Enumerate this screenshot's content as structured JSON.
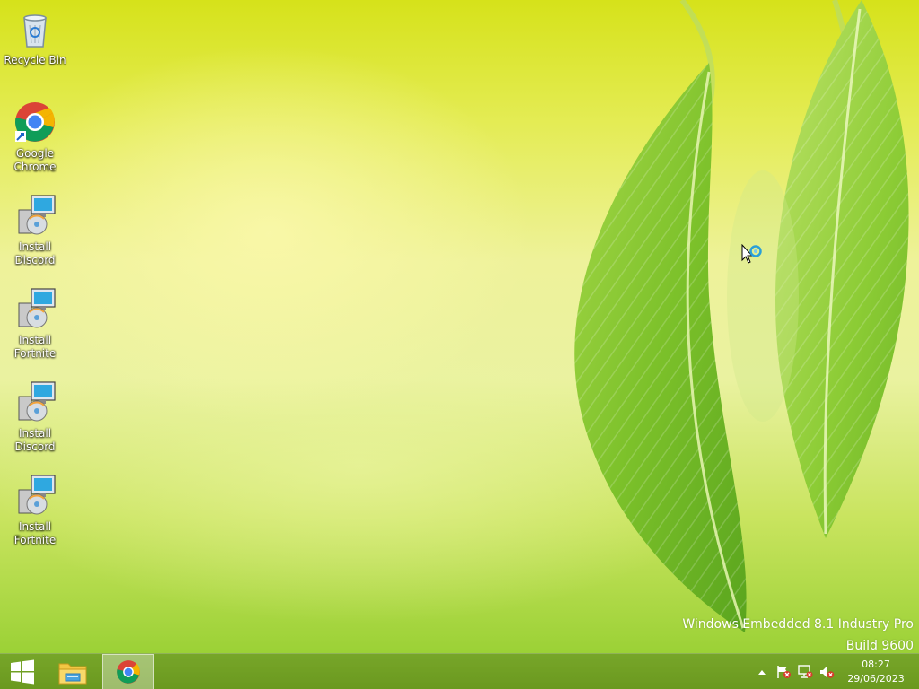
{
  "desktop": {
    "icons": [
      {
        "label": "Recycle Bin",
        "icon": "recycle-bin-icon"
      },
      {
        "label": "Google Chrome",
        "icon": "chrome-icon"
      },
      {
        "label": "Install Discord",
        "icon": "installer-icon"
      },
      {
        "label": "Install Fortnite",
        "icon": "installer-icon"
      },
      {
        "label": "Install Discord",
        "icon": "installer-icon"
      },
      {
        "label": "Install Fortnite",
        "icon": "installer-icon"
      }
    ]
  },
  "watermark": {
    "line1": "Windows Embedded 8.1 Industry Pro",
    "line2": "Build 9600"
  },
  "taskbar": {
    "start_icon": "windows-logo-icon",
    "pinned": [
      {
        "name": "File Explorer",
        "icon": "folder-icon"
      },
      {
        "name": "Google Chrome",
        "icon": "chrome-icon",
        "active": true
      }
    ],
    "tray": {
      "icons": [
        "show-hidden-icons-chevron",
        "action-center-flag-icon",
        "network-icon",
        "volume-muted-icon"
      ],
      "time": "08:27",
      "date": "29/06/2023"
    }
  },
  "colors": {
    "taskbar": "#6e9c24",
    "wallpaper_top": "#d6e21a",
    "wallpaper_bottom": "#8fcc2b"
  }
}
